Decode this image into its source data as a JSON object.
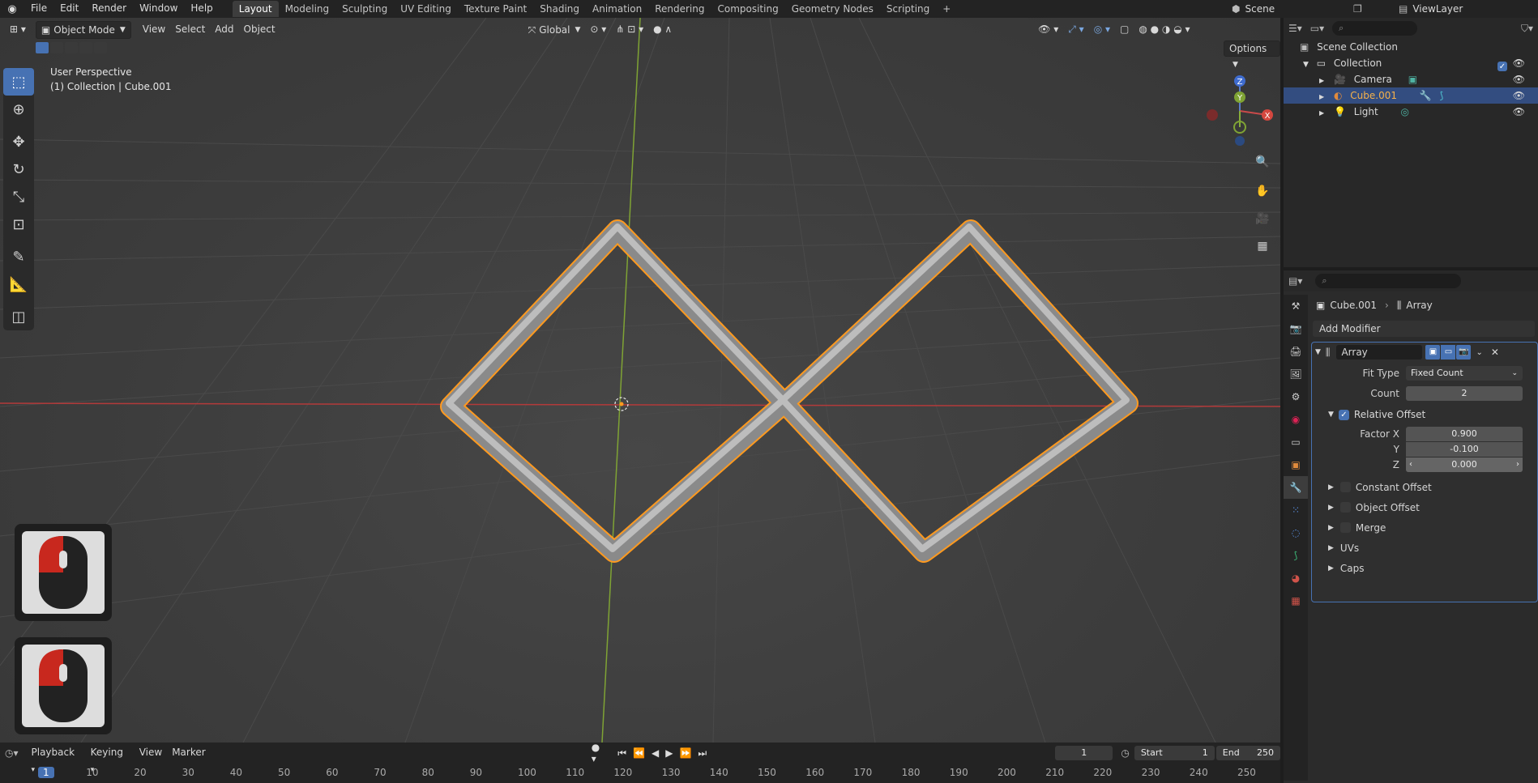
{
  "topbar": {
    "menus": [
      "File",
      "Edit",
      "Render",
      "Window",
      "Help"
    ],
    "workspaces": [
      "Layout",
      "Modeling",
      "Sculpting",
      "UV Editing",
      "Texture Paint",
      "Shading",
      "Animation",
      "Rendering",
      "Compositing",
      "Geometry Nodes",
      "Scripting"
    ],
    "active_workspace": "Layout",
    "scene": "Scene",
    "view_layer": "ViewLayer"
  },
  "viewport": {
    "mode": "Object Mode",
    "menus": [
      "View",
      "Select",
      "Add",
      "Object"
    ],
    "transform_orientation": "Global",
    "options_label": "Options",
    "overlay_line1": "User Perspective",
    "overlay_line2": "(1) Collection | Cube.001",
    "gizmo_axes": [
      "Z",
      "Y",
      "X"
    ]
  },
  "outliner": {
    "root": "Scene Collection",
    "collection": "Collection",
    "items": [
      {
        "name": "Camera",
        "selected": false
      },
      {
        "name": "Cube.001",
        "selected": true
      },
      {
        "name": "Light",
        "selected": false
      }
    ]
  },
  "properties": {
    "breadcrumb_object": "Cube.001",
    "breadcrumb_modifier": "Array",
    "add_modifier": "Add Modifier",
    "modifier_name": "Array",
    "fit_type_label": "Fit Type",
    "fit_type_value": "Fixed Count",
    "count_label": "Count",
    "count_value": "2",
    "relative_offset_label": "Relative Offset",
    "factor_x_label": "Factor X",
    "factor_x": "0.900",
    "y_label": "Y",
    "factor_y": "-0.100",
    "z_label": "Z",
    "factor_z": "0.000",
    "subpanels": [
      "Constant Offset",
      "Object Offset",
      "Merge",
      "UVs",
      "Caps"
    ]
  },
  "timeline": {
    "menus": [
      "Playback",
      "Keying",
      "View",
      "Marker"
    ],
    "current_frame": "1",
    "start_label": "Start",
    "start_value": "1",
    "end_label": "End",
    "end_value": "250",
    "ticks": [
      "1",
      "10",
      "20",
      "30",
      "40",
      "50",
      "60",
      "70",
      "80",
      "90",
      "100",
      "110",
      "120",
      "130",
      "140",
      "150",
      "160",
      "170",
      "180",
      "190",
      "200",
      "210",
      "220",
      "230",
      "240",
      "250"
    ]
  },
  "colors": {
    "accent": "#4772b3",
    "selection_outline": "#ff9a1f",
    "x_axis": "#b33a3a",
    "y_axis": "#7fa334"
  }
}
